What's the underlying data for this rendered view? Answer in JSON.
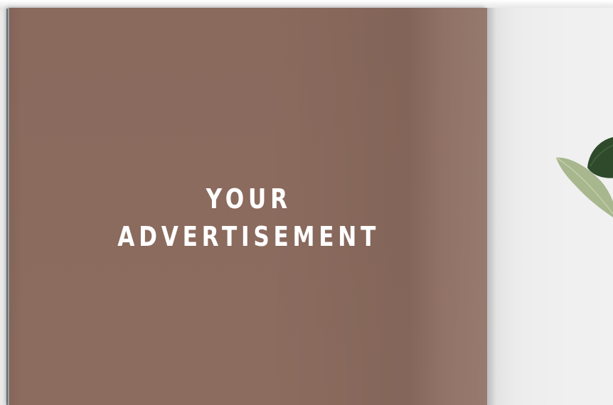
{
  "advertisement": {
    "line1": "YOUR",
    "line2": "ADVERTISEMENT"
  },
  "colors": {
    "ad_background": "#8a6a5d",
    "headline_text": "#ffffff",
    "right_page": "#eeeeee",
    "leaf_dark": "#2f4a2c",
    "leaf_light": "#a9b98f"
  },
  "icons": {
    "plant": "plant-leaf-illustration"
  }
}
